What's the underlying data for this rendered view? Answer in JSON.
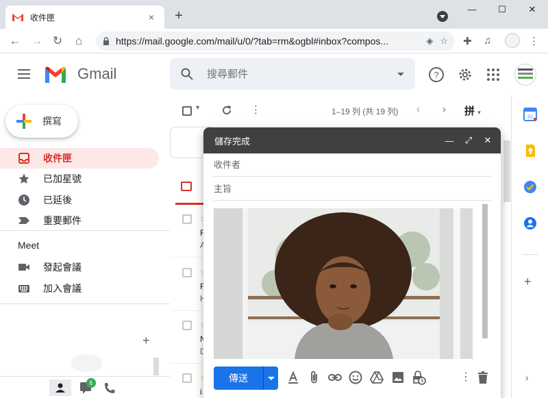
{
  "browser": {
    "tab_title": "收件匣",
    "new_tab": "+",
    "close_tab": "×",
    "window_controls": [
      "—",
      "☐",
      "✕"
    ],
    "url": "https://mail.google.com/mail/u/0/?tab=rm&ogbl#inbox?compos..."
  },
  "header": {
    "brand": "Gmail",
    "search_placeholder": "搜尋郵件"
  },
  "sidebar": {
    "compose_label": "撰寫",
    "items": [
      {
        "label": "收件匣",
        "icon": "inbox-icon",
        "active": true
      },
      {
        "label": "已加星號",
        "icon": "star-icon",
        "active": false
      },
      {
        "label": "已延後",
        "icon": "clock-icon",
        "active": false
      },
      {
        "label": "重要郵件",
        "icon": "important-icon",
        "active": false
      }
    ],
    "meet_title": "Meet",
    "meet_items": [
      {
        "label": "發起會議",
        "icon": "video-icon"
      },
      {
        "label": "加入會議",
        "icon": "keyboard-icon"
      }
    ],
    "hangouts_plus": "+",
    "chat_badge": "6"
  },
  "list": {
    "range": "1–19 列 (共 19 列)",
    "ime": "拼",
    "rows": [
      {
        "l1": "F",
        "l2": "A"
      },
      {
        "l1": "F",
        "l2": "H"
      },
      {
        "l1": "N",
        "l2": "D"
      },
      {
        "l1": "i",
        "l2": ""
      }
    ]
  },
  "compose": {
    "title": "儲存完成",
    "to_placeholder": "收件者",
    "subject_placeholder": "主旨",
    "send_label": "傳送"
  },
  "side_panel": {
    "calendar_day": "31",
    "add": "+",
    "expand": "›"
  },
  "colors": {
    "accent_red": "#d93025",
    "send_blue": "#1a73e8",
    "compose_header": "#404040"
  }
}
